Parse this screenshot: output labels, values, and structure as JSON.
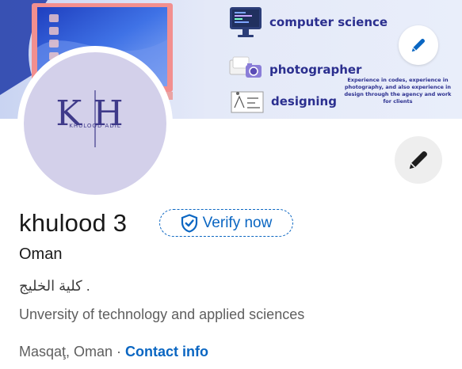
{
  "banner": {
    "skills": [
      {
        "label": "computer science",
        "icon": "monitor-code-icon"
      },
      {
        "label": "photographer",
        "icon": "camera-icon"
      },
      {
        "label": "designing",
        "icon": "sketch-icon"
      }
    ],
    "description": "Experience in codes, experience in photography, and also experience in design through the agency and work for clients",
    "edit_icon": "pencil-icon"
  },
  "avatar": {
    "monogram": "KH",
    "logo_name": "KHULOOD ADIL",
    "bg_color": "#d3d0ea",
    "text_color": "#3f3a8a"
  },
  "profile": {
    "name": "khulood 3",
    "verify_label": "Verify now",
    "verify_icon": "shield-check-icon",
    "headline": "Oman",
    "org": "كلية الخليج",
    "org_suffix": ".",
    "education": "Unversity of technology and applied sciences",
    "location": "Masqaţ, Oman",
    "separator": "·",
    "contact_label": "Contact info",
    "edit_icon": "pencil-icon"
  },
  "colors": {
    "link": "#0a66c2",
    "primary_text": "#191919",
    "secondary_text": "#5e5e5e"
  }
}
